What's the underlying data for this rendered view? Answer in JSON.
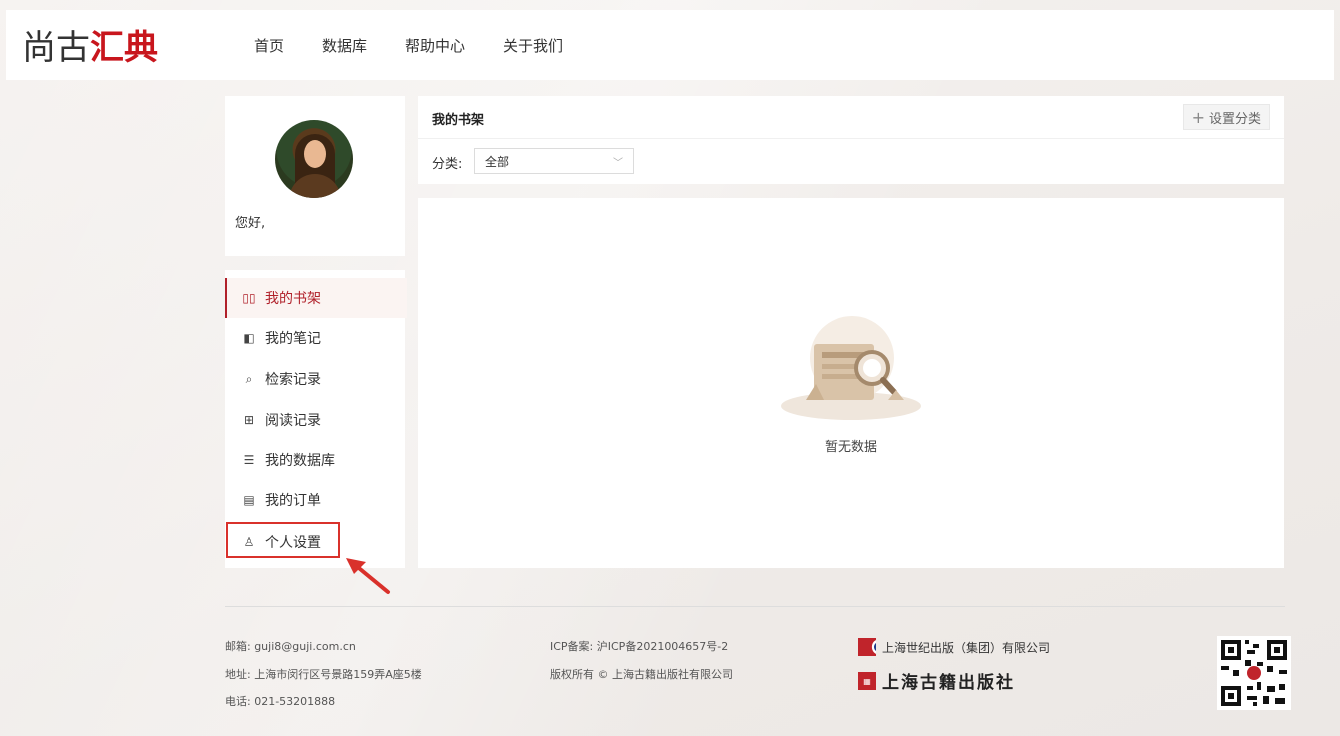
{
  "logo": {
    "part1": "尚古",
    "part2": "汇典"
  },
  "nav": [
    "首页",
    "数据库",
    "帮助中心",
    "关于我们"
  ],
  "profile": {
    "greeting": "您好,"
  },
  "menu": [
    {
      "label": "我的书架",
      "icon": "bookshelf-icon",
      "glyph": "▯▯",
      "active": true
    },
    {
      "label": "我的笔记",
      "icon": "notebook-icon",
      "glyph": "◧",
      "active": false
    },
    {
      "label": "检索记录",
      "icon": "search-record-icon",
      "glyph": "⌕",
      "active": false
    },
    {
      "label": "阅读记录",
      "icon": "open-book-icon",
      "glyph": "⊞",
      "active": false
    },
    {
      "label": "我的数据库",
      "icon": "database-icon",
      "glyph": "☰",
      "active": false
    },
    {
      "label": "我的订单",
      "icon": "order-icon",
      "glyph": "▤",
      "active": false
    },
    {
      "label": "个人设置",
      "icon": "user-icon",
      "glyph": "♙",
      "active": false
    }
  ],
  "shelf": {
    "title": "我的书架",
    "add_category": "设置分类",
    "category_label": "分类:",
    "category_value": "全部",
    "empty_text": "暂无数据"
  },
  "footer": {
    "email": "邮箱: guji8@guji.com.cn",
    "address": "地址: 上海市闵行区号景路159弄A座5楼",
    "phone": "电话: 021-53201888",
    "icp": "ICP备案: 沪ICP备2021004657号-2",
    "copyright": "版权所有 © 上海古籍出版社有限公司",
    "publisher1": "上海世纪出版（集团）有限公司",
    "publisher2": "上海古籍出版社"
  },
  "colors": {
    "brand_red": "#c8161d",
    "accent": "#b0202a",
    "highlight": "#d9312b"
  }
}
